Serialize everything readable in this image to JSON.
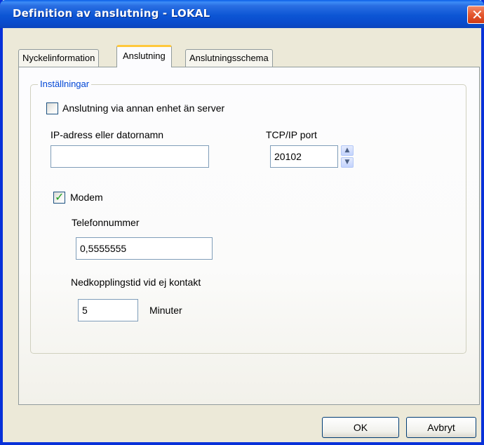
{
  "window": {
    "title": "Definition av anslutning - LOKAL",
    "close_glyph": "✕"
  },
  "tabs": [
    {
      "label": "Nyckelinformation"
    },
    {
      "label": "Anslutning"
    },
    {
      "label": "Anslutningsschema"
    }
  ],
  "group": {
    "title": "Inställningar",
    "via_other_device": {
      "label": "Anslutning via annan enhet än server",
      "checked": false
    },
    "ip_label": "IP-adress eller datornamn",
    "ip_value": "",
    "port_label": "TCP/IP port",
    "port_value": "20102",
    "modem": {
      "label": "Modem",
      "checked": true,
      "phone_label": "Telefonnummer",
      "phone_value": "0,5555555",
      "timeout_label": "Nedkopplingstid vid ej kontakt",
      "timeout_value": "5",
      "timeout_unit": "Minuter"
    }
  },
  "buttons": {
    "ok": "OK",
    "cancel": "Avbryt"
  },
  "icons": {
    "check": "check-icon",
    "spin_up": "spin-up-icon",
    "spin_down": "spin-down-icon",
    "close": "close-icon"
  },
  "colors": {
    "title_bar": "#0a4ccd",
    "accent_tab": "#ffc83c",
    "group_title": "#0046d5",
    "check": "#21a121"
  }
}
